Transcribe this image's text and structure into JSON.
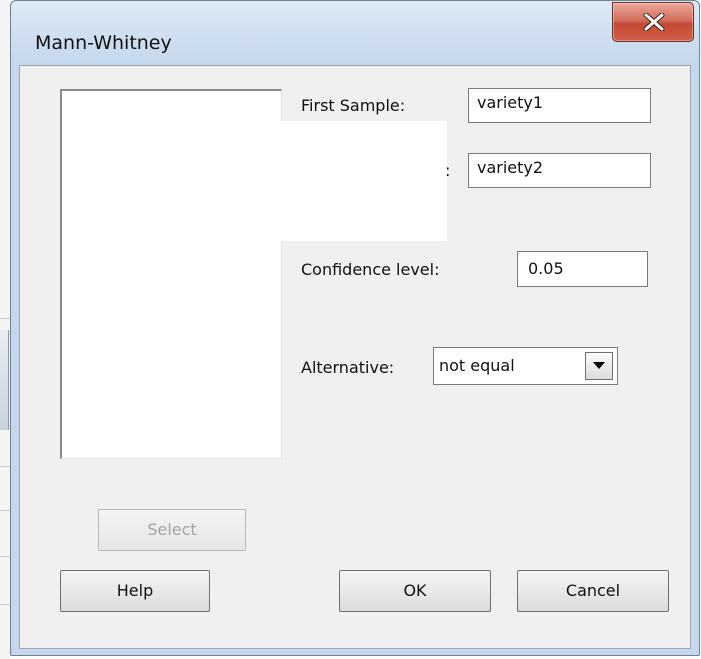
{
  "window": {
    "title": "Mann-Whitney"
  },
  "form": {
    "first_sample_label": "First Sample:",
    "first_sample_value": "variety1",
    "second_sample_label_fragment": ":",
    "second_sample_value": "variety2",
    "confidence_label": "Confidence level:",
    "confidence_value": "0.05",
    "alternative_label": "Alternative:",
    "alternative_value": "not equal"
  },
  "buttons": {
    "select": "Select",
    "help": "Help",
    "ok": "OK",
    "cancel": "Cancel"
  },
  "icons": {
    "close": "close-icon",
    "dropdown": "chevron-down-icon"
  },
  "colors": {
    "close_button": "#c24a36",
    "titlebar": "#c4d7ec",
    "client_bg": "#f0f0f0"
  }
}
